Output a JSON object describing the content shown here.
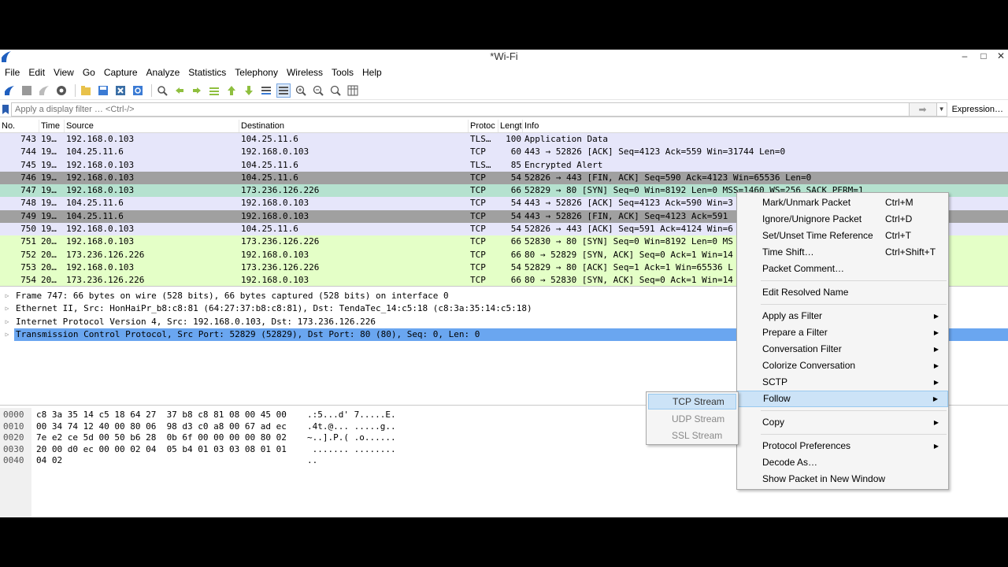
{
  "window": {
    "title": "*Wi-Fi",
    "minimize": "–",
    "maximize": "□",
    "close": "✕"
  },
  "menubar": [
    "File",
    "Edit",
    "View",
    "Go",
    "Capture",
    "Analyze",
    "Statistics",
    "Telephony",
    "Wireless",
    "Tools",
    "Help"
  ],
  "filter": {
    "placeholder": "Apply a display filter … <Ctrl-/>",
    "apply": "➡",
    "expression": "Expression…"
  },
  "packet_list": {
    "headers": {
      "no": "No.",
      "time": "Time",
      "source": "Source",
      "destination": "Destination",
      "protocol": "Protoc",
      "length": "Lengt",
      "info": "Info"
    },
    "rows": [
      {
        "no": "743",
        "time": "19…",
        "src": "192.168.0.103",
        "dst": "104.25.11.6",
        "proto": "TLS…",
        "len": "100",
        "info": "Application Data",
        "bg": "#e6e6fa"
      },
      {
        "no": "744",
        "time": "19…",
        "src": "104.25.11.6",
        "dst": "192.168.0.103",
        "proto": "TCP",
        "len": "60",
        "info": "443 → 52826 [ACK] Seq=4123 Ack=559 Win=31744 Len=0",
        "bg": "#e6e6fa"
      },
      {
        "no": "745",
        "time": "19…",
        "src": "192.168.0.103",
        "dst": "104.25.11.6",
        "proto": "TLS…",
        "len": "85",
        "info": "Encrypted Alert",
        "bg": "#e6e6fa"
      },
      {
        "no": "746",
        "time": "19…",
        "src": "192.168.0.103",
        "dst": "104.25.11.6",
        "proto": "TCP",
        "len": "54",
        "info": "52826 → 443 [FIN, ACK] Seq=590 Ack=4123 Win=65536 Len=0",
        "bg": "#a0a0a0"
      },
      {
        "no": "747",
        "time": "19…",
        "src": "192.168.0.103",
        "dst": "173.236.126.226",
        "proto": "TCP",
        "len": "66",
        "info": "52829 → 80 [SYN] Seq=0 Win=8192 Len=0 MSS=1460 WS=256 SACK_PERM=1",
        "bg": "#b5e2cf"
      },
      {
        "no": "748",
        "time": "19…",
        "src": "104.25.11.6",
        "dst": "192.168.0.103",
        "proto": "TCP",
        "len": "54",
        "info": "443 → 52826 [ACK] Seq=4123 Ack=590 Win=3",
        "bg": "#e6e6fa"
      },
      {
        "no": "749",
        "time": "19…",
        "src": "104.25.11.6",
        "dst": "192.168.0.103",
        "proto": "TCP",
        "len": "54",
        "info": "443 → 52826 [FIN, ACK] Seq=4123 Ack=591",
        "bg": "#a0a0a0"
      },
      {
        "no": "750",
        "time": "19…",
        "src": "192.168.0.103",
        "dst": "104.25.11.6",
        "proto": "TCP",
        "len": "54",
        "info": "52826 → 443 [ACK] Seq=591 Ack=4124 Win=6",
        "bg": "#e6e6fa"
      },
      {
        "no": "751",
        "time": "20…",
        "src": "192.168.0.103",
        "dst": "173.236.126.226",
        "proto": "TCP",
        "len": "66",
        "info": "52830 → 80 [SYN] Seq=0 Win=8192 Len=0 MS",
        "bg": "#e4ffc7"
      },
      {
        "no": "752",
        "time": "20…",
        "src": "173.236.126.226",
        "dst": "192.168.0.103",
        "proto": "TCP",
        "len": "66",
        "info": "80 → 52829 [SYN, ACK] Seq=0 Ack=1 Win=14",
        "bg": "#e4ffc7"
      },
      {
        "no": "753",
        "time": "20…",
        "src": "192.168.0.103",
        "dst": "173.236.126.226",
        "proto": "TCP",
        "len": "54",
        "info": "52829 → 80 [ACK] Seq=1 Ack=1 Win=65536 L",
        "bg": "#e4ffc7"
      },
      {
        "no": "754",
        "time": "20…",
        "src": "173.236.126.226",
        "dst": "192.168.0.103",
        "proto": "TCP",
        "len": "66",
        "info": "80 → 52830 [SYN, ACK] Seq=0 Ack=1 Win=14",
        "bg": "#e4ffc7"
      }
    ]
  },
  "details": [
    "Frame 747: 66 bytes on wire (528 bits), 66 bytes captured (528 bits) on interface 0",
    "Ethernet II, Src: HonHaiPr_b8:c8:81 (64:27:37:b8:c8:81), Dst: TendaTec_14:c5:18 (c8:3a:35:14:c5:18)",
    "Internet Protocol Version 4, Src: 192.168.0.103, Dst: 173.236.126.226",
    "Transmission Control Protocol, Src Port: 52829 (52829), Dst Port: 80 (80), Seq: 0, Len: 0"
  ],
  "hex": [
    {
      "offset": "0000",
      "bytes": "c8 3a 35 14 c5 18 64 27  37 b8 c8 81 08 00 45 00",
      "ascii": ".:5...d' 7.....E."
    },
    {
      "offset": "0010",
      "bytes": "00 34 74 12 40 00 80 06  98 d3 c0 a8 00 67 ad ec",
      "ascii": ".4t.@... .....g.."
    },
    {
      "offset": "0020",
      "bytes": "7e e2 ce 5d 00 50 b6 28  0b 6f 00 00 00 00 80 02",
      "ascii": "~..].P.( .o......"
    },
    {
      "offset": "0030",
      "bytes": "20 00 d0 ec 00 00 02 04  05 b4 01 03 03 08 01 01",
      "ascii": " ....... ........"
    },
    {
      "offset": "0040",
      "bytes": "04 02",
      "ascii": ".."
    }
  ],
  "context_menu": {
    "items": [
      {
        "label": "Mark/Unmark Packet",
        "shortcut": "Ctrl+M"
      },
      {
        "label": "Ignore/Unignore Packet",
        "shortcut": "Ctrl+D"
      },
      {
        "label": "Set/Unset Time Reference",
        "shortcut": "Ctrl+T"
      },
      {
        "label": "Time Shift…",
        "shortcut": "Ctrl+Shift+T"
      },
      {
        "label": "Packet Comment…"
      },
      {
        "label": "Edit Resolved Name"
      },
      {
        "label": "Apply as Filter"
      },
      {
        "label": "Prepare a Filter"
      },
      {
        "label": "Conversation Filter"
      },
      {
        "label": "Colorize Conversation"
      },
      {
        "label": "SCTP"
      },
      {
        "label": "Follow"
      },
      {
        "label": "Copy"
      },
      {
        "label": "Protocol Preferences"
      },
      {
        "label": "Decode As…"
      },
      {
        "label": "Show Packet in New Window"
      }
    ],
    "submenu_arrow": "▶"
  },
  "follow_submenu": [
    "TCP Stream",
    "UDP Stream",
    "SSL Stream"
  ],
  "colors": {
    "selected_detail": "#6aa6f0",
    "menu_highlight": "#cce3f7"
  }
}
